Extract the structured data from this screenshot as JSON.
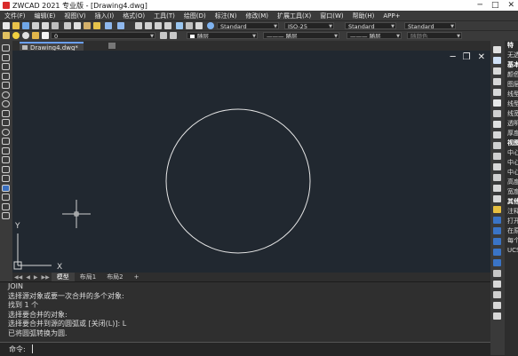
{
  "app": {
    "title": "ZWCAD 2021 专业版 - [Drawing4.dwg]",
    "win_min": "─",
    "win_max": "□",
    "win_close": "✕"
  },
  "menu": [
    "文件(F)",
    "编辑(E)",
    "视图(V)",
    "插入(I)",
    "格式(O)",
    "工具(T)",
    "绘图(D)",
    "标注(N)",
    "修改(M)",
    "扩展工具(X)",
    "窗口(W)",
    "帮助(H)",
    "APP+"
  ],
  "toolbar": {
    "text_style": "Standard",
    "dim_style": "ISO-25",
    "table_style": "Standard",
    "multileader_style": "Standard",
    "layer": "0",
    "color": "随层",
    "linetype": "随层",
    "lineweight": "随层",
    "plot_style": "随颜色"
  },
  "tabs": {
    "doc_tab": "Drawing4.dwg*"
  },
  "layout_tabs": {
    "nav": [
      "◀◀",
      "◀",
      "▶",
      "▶▶"
    ],
    "items": [
      "模型",
      "布局1",
      "布局2",
      "+"
    ]
  },
  "canvas": {
    "background": "#212830",
    "axis_x": "X",
    "axis_y": "Y",
    "circle_color": "#e6e6e6",
    "win_min": "─",
    "win_restore": "❐",
    "win_close": "✕"
  },
  "command_history": [
    "JOIN",
    "选择源对象或要一次合并的多个对象:",
    "找到 1 个",
    "选择要合并的对象:",
    "选择要合并到源的圆弧或 [关闭(L)]: L",
    "已将圆弧转换为圆."
  ],
  "command_prompt": "命令:",
  "properties_panel": [
    {
      "text": "特",
      "hdr": true
    },
    {
      "text": "无选",
      "hdr": false
    },
    {
      "text": "基本",
      "hdr": true
    },
    {
      "text": "颜色",
      "hdr": false
    },
    {
      "text": "图层",
      "hdr": false
    },
    {
      "text": "线型",
      "hdr": false
    },
    {
      "text": "线型",
      "hdr": false
    },
    {
      "text": "线宽",
      "hdr": false
    },
    {
      "text": "透明",
      "hdr": false
    },
    {
      "text": "厚度",
      "hdr": false
    },
    {
      "text": "视图",
      "hdr": true
    },
    {
      "text": "中心",
      "hdr": false
    },
    {
      "text": "中心",
      "hdr": false
    },
    {
      "text": "中心",
      "hdr": false
    },
    {
      "text": "高度",
      "hdr": false
    },
    {
      "text": "宽度",
      "hdr": false
    },
    {
      "text": "其他",
      "hdr": true
    },
    {
      "text": "注释",
      "hdr": false
    },
    {
      "text": "打开",
      "hdr": false
    },
    {
      "text": "在原",
      "hdr": false
    },
    {
      "text": "每个",
      "hdr": false
    },
    {
      "text": "UCS",
      "hdr": false
    }
  ]
}
